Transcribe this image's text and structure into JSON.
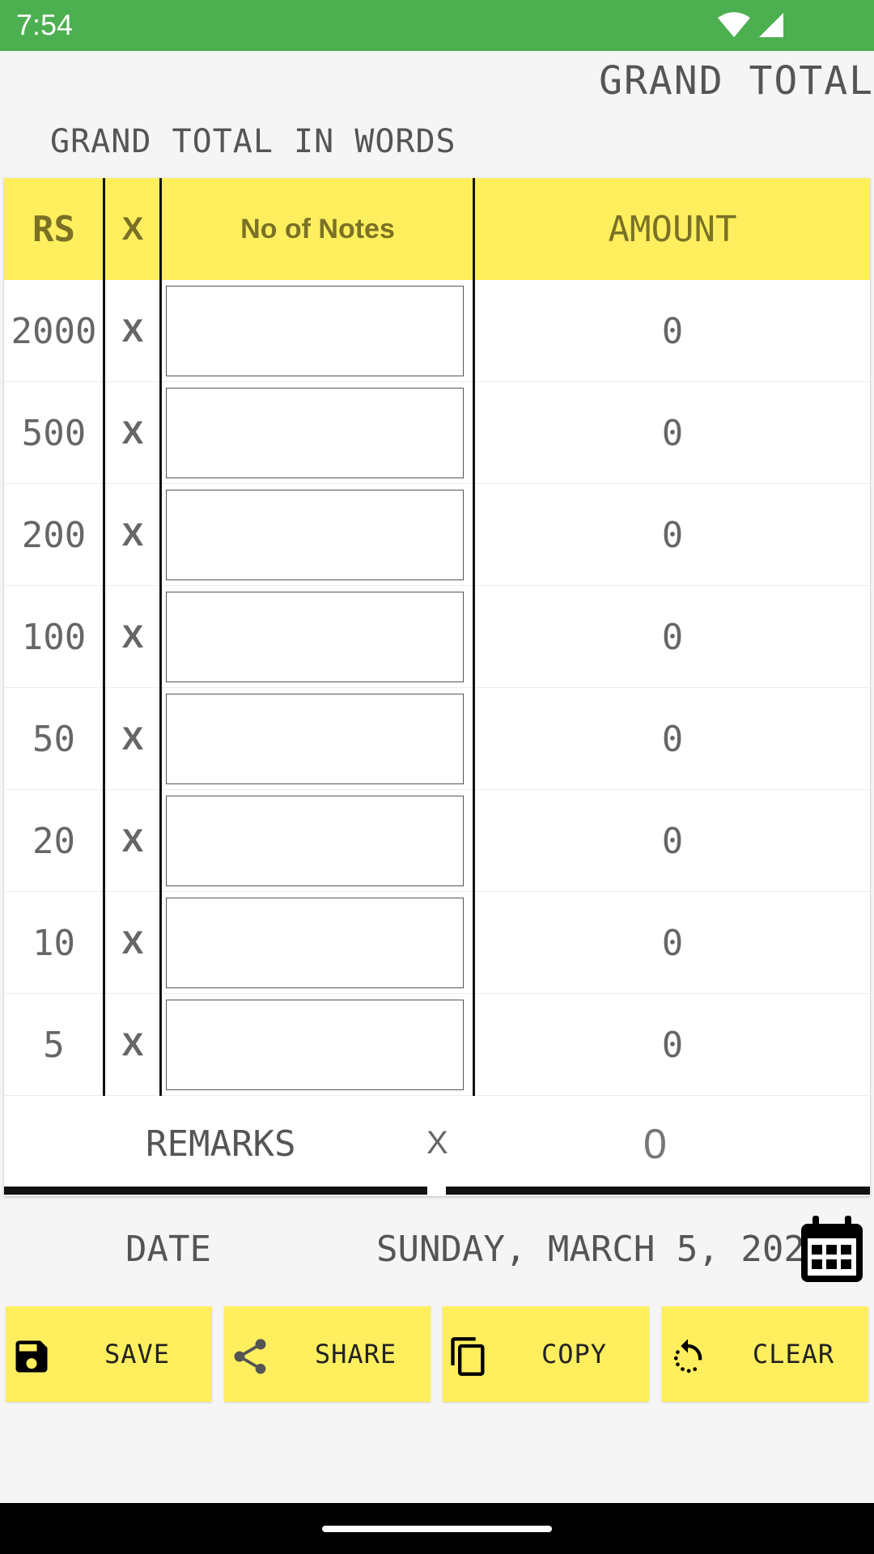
{
  "status_bar": {
    "time": "7:54"
  },
  "header": {
    "grand_total": "GRAND TOTAL",
    "grand_total_words": "GRAND TOTAL IN WORDS"
  },
  "table": {
    "headers": {
      "rs": "RS",
      "x": "X",
      "notes": "No of Notes",
      "amount": "AMOUNT"
    },
    "rows": [
      {
        "rs": "2000",
        "x": "X",
        "notes": "",
        "amount": "0"
      },
      {
        "rs": "500",
        "x": "X",
        "notes": "",
        "amount": "0"
      },
      {
        "rs": "200",
        "x": "X",
        "notes": "",
        "amount": "0"
      },
      {
        "rs": "100",
        "x": "X",
        "notes": "",
        "amount": "0"
      },
      {
        "rs": "50",
        "x": "X",
        "notes": "",
        "amount": "0"
      },
      {
        "rs": "20",
        "x": "X",
        "notes": "",
        "amount": "0"
      },
      {
        "rs": "10",
        "x": "X",
        "notes": "",
        "amount": "0"
      },
      {
        "rs": "5",
        "x": "X",
        "notes": "",
        "amount": "0"
      }
    ],
    "remarks": {
      "label": "REMARKS",
      "x": "X",
      "value": "0"
    }
  },
  "date": {
    "label": "DATE",
    "value": "SUNDAY, MARCH 5, 2023",
    "icon": "calendar-icon"
  },
  "actions": [
    {
      "label": "SAVE",
      "icon": "save-icon"
    },
    {
      "label": "SHARE",
      "icon": "share-icon"
    },
    {
      "label": "COPY",
      "icon": "copy-icon"
    },
    {
      "label": "CLEAR",
      "icon": "refresh-icon"
    }
  ],
  "colors": {
    "status_bar": "#4caf50",
    "accent_yellow": "#ffef5e",
    "header_text": "#7a7126"
  }
}
